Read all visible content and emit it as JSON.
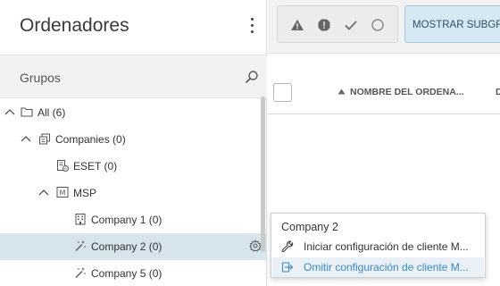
{
  "header": {
    "title": "Ordenadores"
  },
  "groups_bar": {
    "label": "Grupos"
  },
  "tree": [
    {
      "label": "All (6)",
      "level": 0,
      "expanded": true,
      "icon": "folder-icon"
    },
    {
      "label": "Companies (0)",
      "level": 1,
      "expanded": true,
      "icon": "companies-icon"
    },
    {
      "label": "ESET (0)",
      "level": 2,
      "icon": "eset-company-icon"
    },
    {
      "label": "MSP",
      "level": 2,
      "expanded": true,
      "icon": "msp-icon"
    },
    {
      "label": "Company 1 (0)",
      "level": 3,
      "icon": "building-icon"
    },
    {
      "label": "Company 2 (0)",
      "level": 3,
      "icon": "wand-icon",
      "selected": true
    },
    {
      "label": "Company 5 (0)",
      "level": 3,
      "icon": "wand-icon"
    }
  ],
  "filters": {
    "status_icons": [
      "warning-icon",
      "exclamation-icon",
      "check-icon",
      "circle-icon"
    ],
    "subgroup_button": "MOSTRAR SUBGRU"
  },
  "table": {
    "columns": [
      {
        "label": "NOMBRE DEL ORDENA..."
      },
      {
        "label": "D"
      }
    ]
  },
  "context_menu": {
    "title": "Company 2",
    "items": [
      {
        "label": "Iniciar configuración de cliente M...",
        "icon": "wrench-icon"
      },
      {
        "label": "Omitir configuración de cliente M...",
        "icon": "skip-icon"
      }
    ]
  },
  "colors": {
    "selected_row": "#d6e4ec",
    "accent_blue": "#3a88c4",
    "subgroup_bg": "#d6e9f3"
  }
}
